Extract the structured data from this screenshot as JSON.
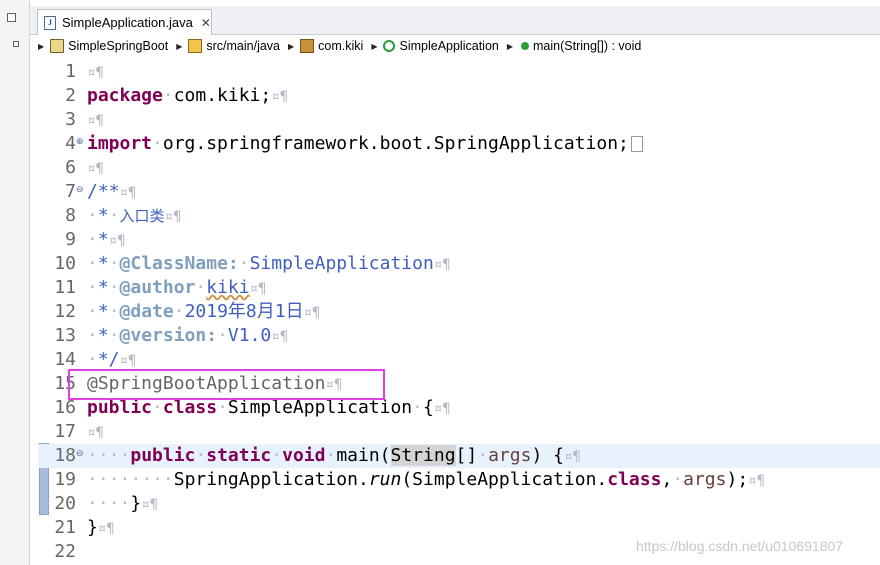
{
  "editor_tab": {
    "title": "SimpleApplication.java",
    "close_glyph": "✕"
  },
  "breadcrumb": [
    {
      "label": "SimpleSpringBoot",
      "icon": "project-icon"
    },
    {
      "label": "src/main/java",
      "icon": "source-folder-icon"
    },
    {
      "label": "com.kiki",
      "icon": "package-icon"
    },
    {
      "label": "SimpleApplication",
      "icon": "class-icon"
    },
    {
      "label": "main(String[]) : void",
      "icon": "method-icon"
    }
  ],
  "code": {
    "l2_kw": "package",
    "l2_rest": "com.kiki;",
    "l4_kw": "import",
    "l4_rest": "org.springframework.boot.SpringApplication;",
    "l7": "/**",
    "l8_star": "*",
    "l8_text": "入口类",
    "l9_star": "*",
    "l10_star": "*",
    "l10_tag": "@ClassName:",
    "l10_val": "SimpleApplication",
    "l11_star": "*",
    "l11_tag": "@author",
    "l11_val": "kiki",
    "l12_star": "*",
    "l12_tag": "@date",
    "l12_val": "2019年8月1日",
    "l13_star": "*",
    "l13_tag": "@version:",
    "l13_val": "V1.0",
    "l14": "*/",
    "l15": "@SpringBootApplication",
    "l16_kw1": "public",
    "l16_kw2": "class",
    "l16_name": "SimpleApplication",
    "l16_brace": "{",
    "l18_kw1": "public",
    "l18_kw2": "static",
    "l18_kw3": "void",
    "l18_name": "main(",
    "l18_type": "String",
    "l18_arr": "[]",
    "l18_param": "args",
    "l18_end": ") {",
    "l19_cls": "SpringApplication.",
    "l19_m": "run",
    "l19_a": "(SimpleApplication.",
    "l19_kw": "class",
    "l19_comma": ",",
    "l19_param": "args",
    "l19_end": ");",
    "l20": "}",
    "l21": "}"
  },
  "line_numbers": [
    "1",
    "2",
    "3",
    "4",
    "6",
    "7",
    "8",
    "9",
    "10",
    "11",
    "12",
    "13",
    "14",
    "15",
    "16",
    "17",
    "18",
    "19",
    "20",
    "21",
    "22"
  ],
  "whitespace": {
    "dot": "·",
    "pilcrow": "¤¶"
  },
  "watermark": "https://blog.csdn.net/u010691807",
  "colors": {
    "keyword": "#7f0055",
    "javadoc": "#3f5fbf",
    "javadoc_tag": "#7f9fbf",
    "annotation": "#646464",
    "highlight_box": "#e040e0",
    "current_line": "#e8f2fe"
  }
}
